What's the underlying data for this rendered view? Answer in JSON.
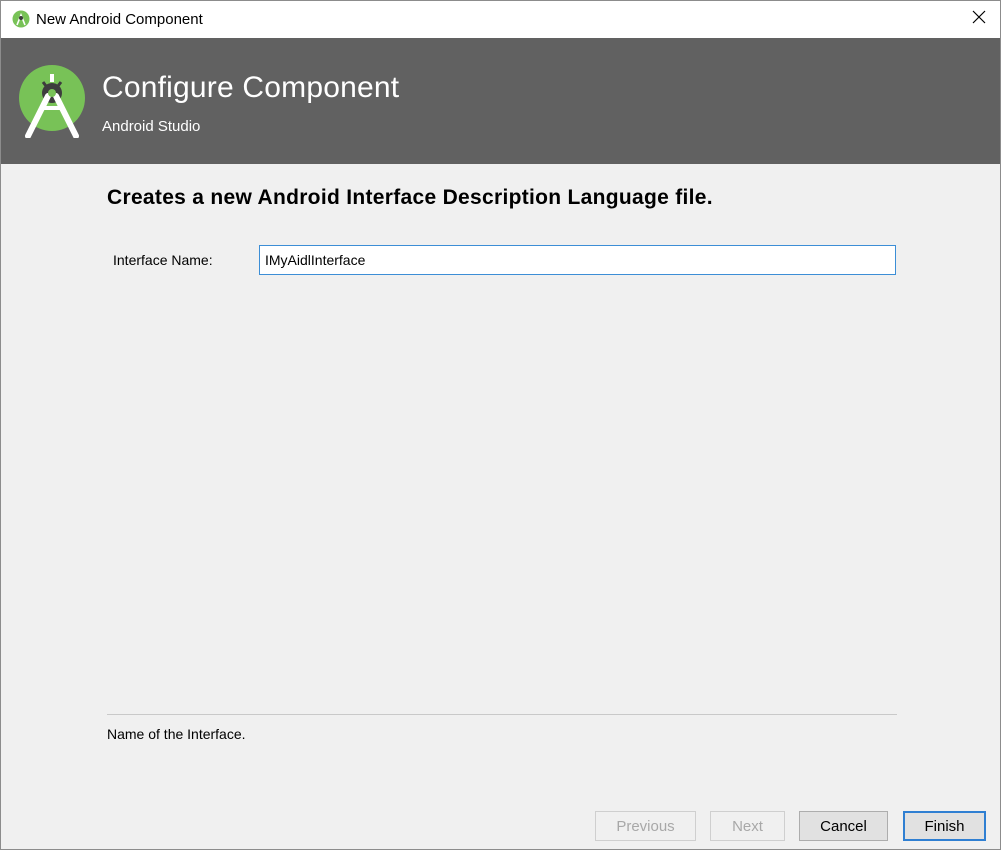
{
  "window": {
    "title": "New Android Component",
    "app_icon": "android-studio-icon",
    "close_icon": "close-icon"
  },
  "banner": {
    "heading": "Configure Component",
    "subheading": "Android Studio",
    "logo_icon": "android-studio-logo-icon",
    "background_color": "#616161",
    "accent_color": "#78c257"
  },
  "content": {
    "description": "Creates a new Android Interface Description Language file.",
    "field": {
      "label": "Interface Name:",
      "value": "IMyAidlInterface"
    },
    "help_text": "Name of the Interface."
  },
  "buttons": {
    "previous": "Previous",
    "next": "Next",
    "cancel": "Cancel",
    "finish": "Finish"
  }
}
